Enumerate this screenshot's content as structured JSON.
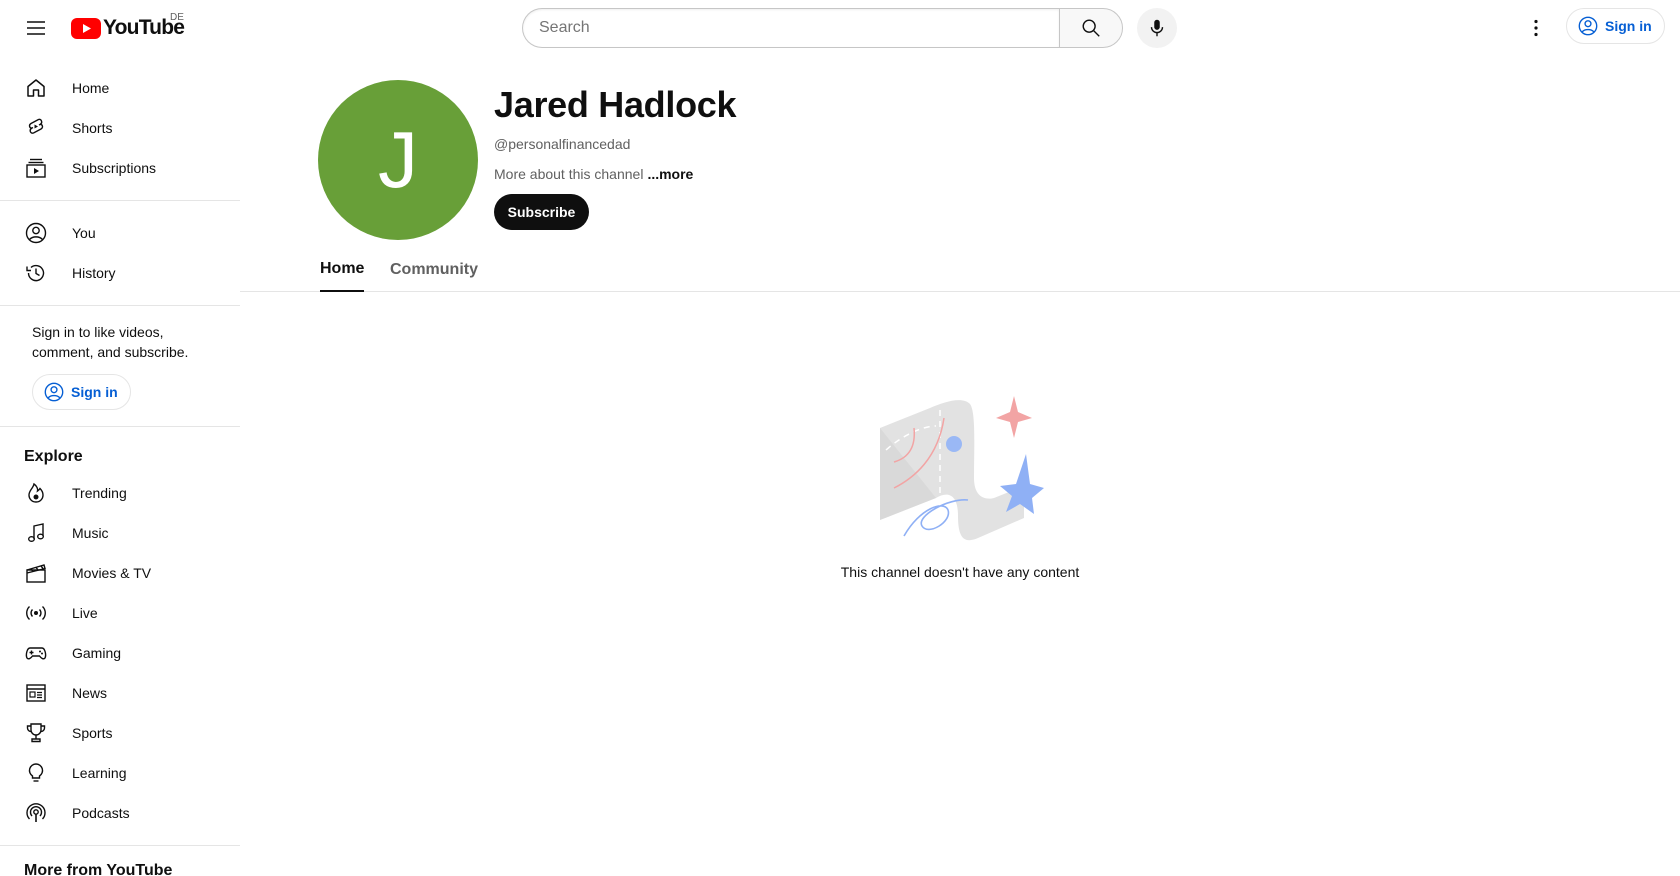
{
  "header": {
    "logo_text": "YouTube",
    "country_code": "DE",
    "search_placeholder": "Search",
    "signin_label": "Sign in"
  },
  "sidebar": {
    "main_items": [
      {
        "label": "Home",
        "icon": "home-icon"
      },
      {
        "label": "Shorts",
        "icon": "shorts-icon"
      },
      {
        "label": "Subscriptions",
        "icon": "subscriptions-icon"
      }
    ],
    "you_items": [
      {
        "label": "You",
        "icon": "account-icon"
      },
      {
        "label": "History",
        "icon": "history-icon"
      }
    ],
    "signin_prompt": "Sign in to like videos, comment, and subscribe.",
    "signin_label": "Sign in",
    "explore_title": "Explore",
    "explore_items": [
      {
        "label": "Trending",
        "icon": "trending-icon"
      },
      {
        "label": "Music",
        "icon": "music-icon"
      },
      {
        "label": "Movies & TV",
        "icon": "movies-icon"
      },
      {
        "label": "Live",
        "icon": "live-icon"
      },
      {
        "label": "Gaming",
        "icon": "gaming-icon"
      },
      {
        "label": "News",
        "icon": "news-icon"
      },
      {
        "label": "Sports",
        "icon": "sports-icon"
      },
      {
        "label": "Learning",
        "icon": "learning-icon"
      },
      {
        "label": "Podcasts",
        "icon": "podcasts-icon"
      }
    ],
    "more_from_title": "More from YouTube"
  },
  "channel": {
    "avatar_letter": "J",
    "avatar_color": "#689f38",
    "name": "Jared Hadlock",
    "handle": "@personalfinancedad",
    "about_text": "More about this channel",
    "more_label": "...more",
    "subscribe_label": "Subscribe"
  },
  "tabs": [
    {
      "label": "Home",
      "active": true
    },
    {
      "label": "Community",
      "active": false
    }
  ],
  "empty_state": {
    "message": "This channel doesn't have any content"
  },
  "colors": {
    "brand_red": "#ff0000",
    "link_blue": "#065fd4"
  }
}
